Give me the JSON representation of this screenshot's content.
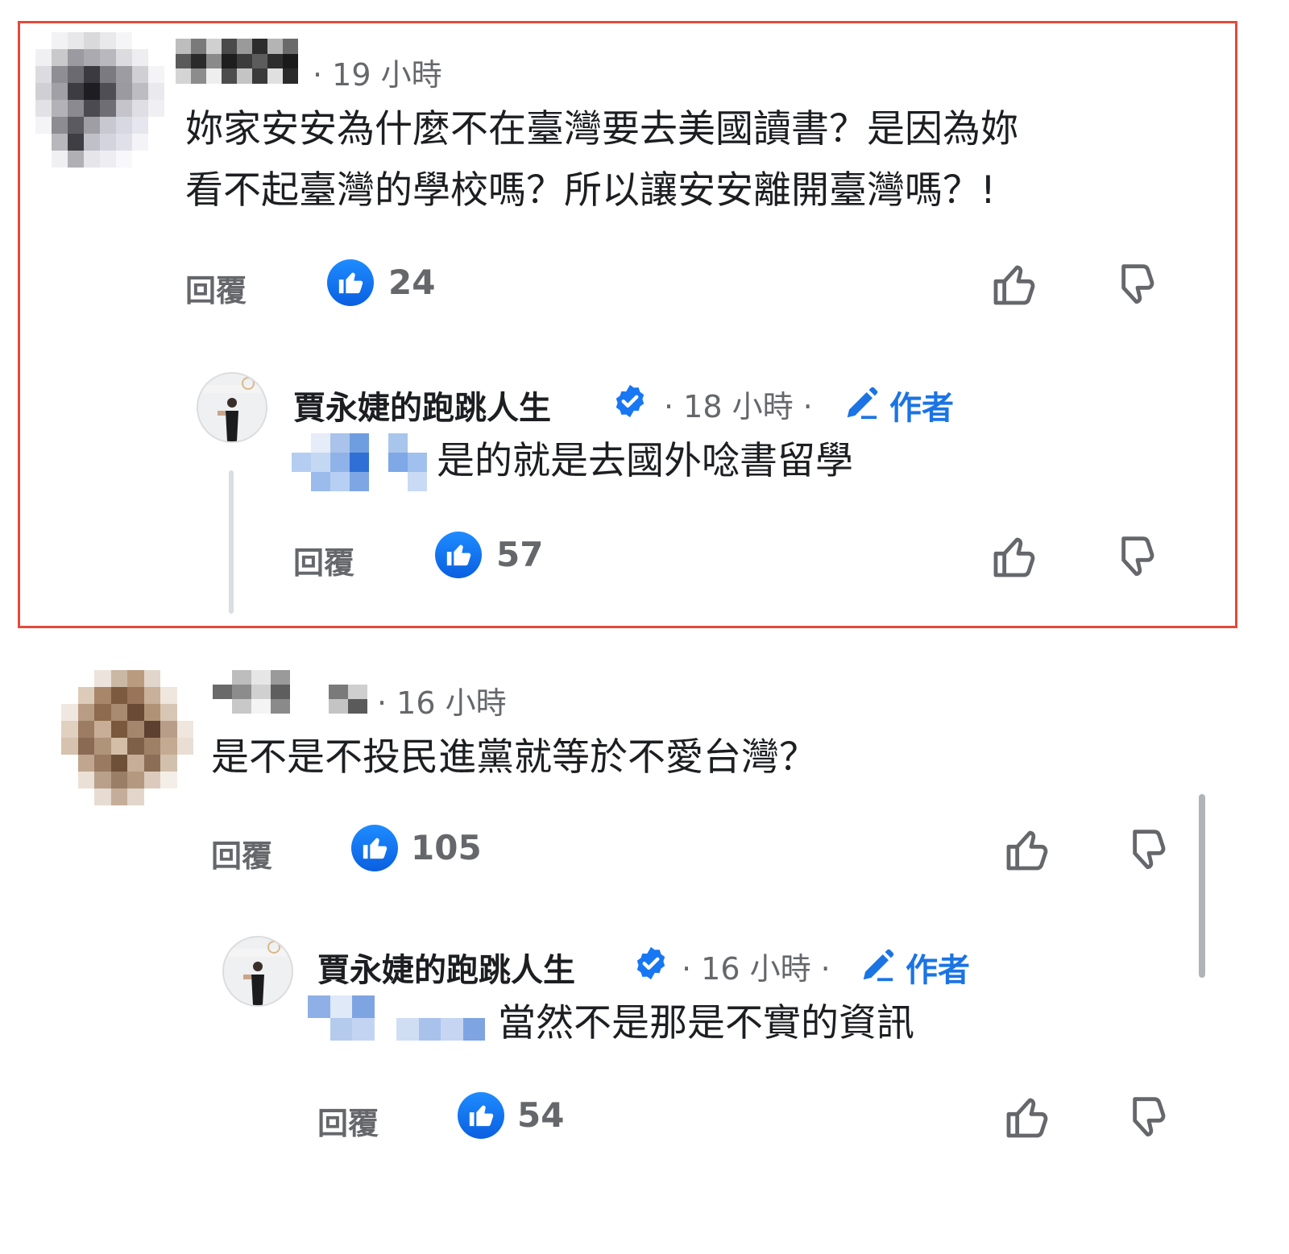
{
  "comments": [
    {
      "time": "· 19 小時",
      "text_lines": [
        "妳家安安為什麼不在臺灣要去美國讀書？是因為妳",
        "看不起臺灣的學校嗎？所以讓安安離開臺灣嗎？!"
      ],
      "reply_label": "回覆",
      "like_count": "24",
      "highlighted": true,
      "reply": {
        "author": "賈永婕的跑跳人生",
        "time": "· 18 小時 ·",
        "author_tag": "作者",
        "text": "是的就是去國外唸書留學",
        "reply_label": "回覆",
        "like_count": "57"
      }
    },
    {
      "time": "· 16 小時",
      "text_lines": [
        "是不是不投民進黨就等於不愛台灣？"
      ],
      "reply_label": "回覆",
      "like_count": "105",
      "highlighted": false,
      "reply": {
        "author": "賈永婕的跑跳人生",
        "time": "· 16 小時 ·",
        "author_tag": "作者",
        "text": "當然不是那是不實的資訊",
        "reply_label": "回覆",
        "like_count": "54"
      }
    }
  ],
  "icons": {
    "like_badge": "like-thumb-icon",
    "thumbs_up": "thumbs-up-icon",
    "thumbs_down": "thumbs-down-icon",
    "verified": "verified-badge-icon",
    "pencil": "pencil-icon"
  },
  "colors": {
    "highlight_border": "#e24a3b",
    "like_blue": "#1877f2",
    "author_tag_blue": "#1b74e4",
    "meta_gray": "#65676b"
  }
}
